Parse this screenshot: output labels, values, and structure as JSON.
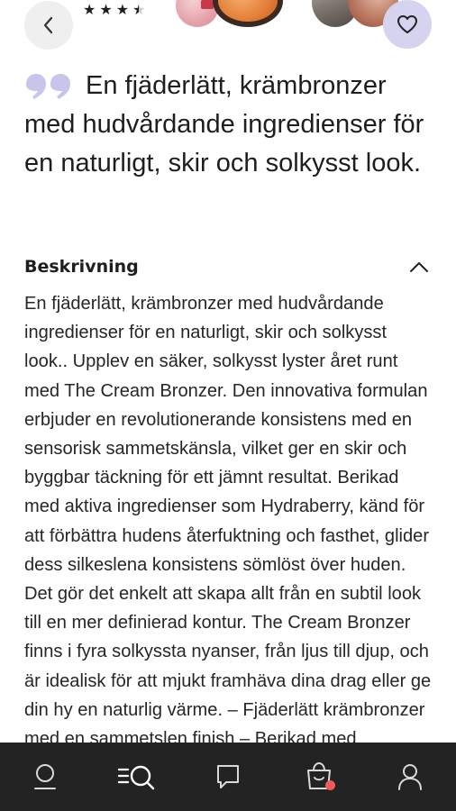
{
  "header": {
    "rating": 3.5,
    "rating_max": 5
  },
  "quote": {
    "text": "En fjäderlätt, krämbronzer med hudvårdande ingredienser för en naturligt, skir och solkysst look.",
    "accent_color": "#c8c5ec"
  },
  "description": {
    "title": "Beskrivning",
    "expanded": true,
    "body": "En fjäderlätt, krämbronzer med hudvårdande ingredienser för en naturligt, skir och solkysst look.. Upplev en säker, solkysst lyster året runt med The Cream Bronzer. Den innovativa formulan erbjuder en revolutionerande konsistens med en sensorisk sammetskänsla, vilket ger en skir och byggbar täckning för ett jämnt resultat. Berikad med aktiva ingredienser som Hydraberry, känd för att förbättra hudens återfuktning och fasthet, glider dess silkeslena konsistens sömlöst över huden. Det gör det enkelt att skapa allt från en subtil look till en mer definierad kontur. The Cream Bronzer finns i fyra solkyssta nyanser, från ljus till djup, och är idealisk för att mjukt framhäva dina drag eller ge din hy en naturlig värme. – Fjäderlätt krämbronzer med en sammetslen finish – Berikad med hudvårdande ingredienser"
  },
  "nav": {
    "items": [
      {
        "icon": "home-icon"
      },
      {
        "icon": "search-icon"
      },
      {
        "icon": "chat-icon"
      },
      {
        "icon": "bag-icon"
      },
      {
        "icon": "profile-icon"
      }
    ],
    "badge_color": "#f15a5a",
    "background": "#232323"
  },
  "colors": {
    "favorite_button": "#d6d3f1",
    "back_button": "#efefef"
  }
}
